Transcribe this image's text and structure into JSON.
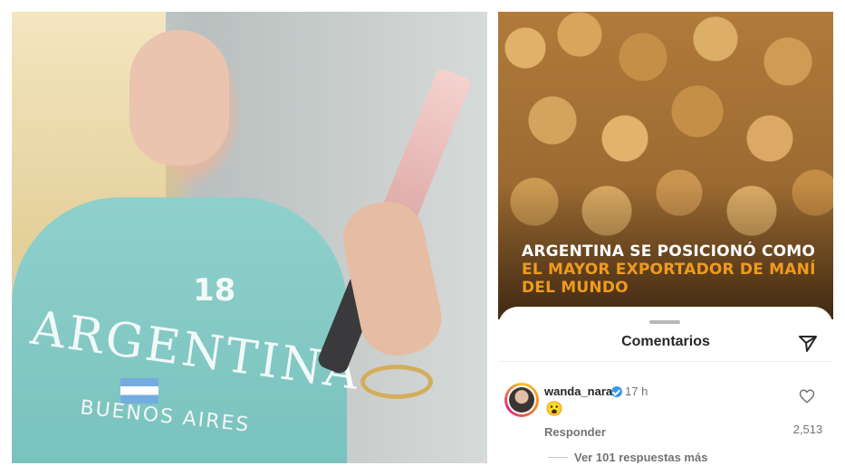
{
  "left_photo": {
    "shirt_text": "ARGENTINA",
    "shirt_number": "18",
    "shirt_subtext": "BUENOS AIRES"
  },
  "post": {
    "headline_part1": "ARGENTINA SE POSICIONÓ COMO ",
    "headline_accent": "EL MAYOR EXPORTADOR DE MANÍ DEL MUNDO",
    "accent_color": "#ef9b1f"
  },
  "comments_sheet": {
    "title": "Comentarios",
    "share_icon": "send-icon"
  },
  "comment": {
    "username": "wanda_nara",
    "verified": true,
    "time": "17 h",
    "text": "😮",
    "reply_label": "Responder",
    "likes": "2,513",
    "view_replies": "Ver 101 respuestas más"
  },
  "colors": {
    "verified_badge": "#3897f0",
    "avatar_ring": "#dd2a7b"
  }
}
